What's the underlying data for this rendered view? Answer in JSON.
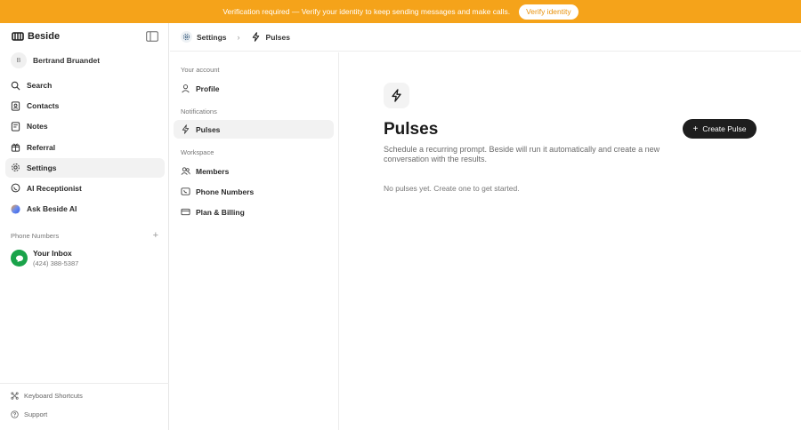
{
  "banner": {
    "message": "Verification required — Verify your identity to keep sending messages and make calls.",
    "button": "Verify identity"
  },
  "brand": {
    "name": "Beside"
  },
  "user": {
    "initial": "B",
    "name": "Bertrand Bruandet"
  },
  "nav": [
    {
      "label": "Search",
      "icon": "search-icon"
    },
    {
      "label": "Contacts",
      "icon": "contacts-icon"
    },
    {
      "label": "Notes",
      "icon": "notes-icon"
    },
    {
      "label": "Referral",
      "icon": "gift-icon"
    },
    {
      "label": "Settings",
      "icon": "gear-icon",
      "active": true
    },
    {
      "label": "AI Receptionist",
      "icon": "receptionist-icon"
    },
    {
      "label": "Ask Beside AI",
      "icon": "ai-orb-icon"
    }
  ],
  "phone_numbers": {
    "heading": "Phone Numbers",
    "inbox": {
      "title": "Your Inbox",
      "number": "(424) 388-5387"
    }
  },
  "footer": {
    "shortcuts": "Keyboard Shortcuts",
    "support": "Support"
  },
  "breadcrumb": {
    "root": "Settings",
    "current": "Pulses"
  },
  "subnav": {
    "account_label": "Your account",
    "profile": "Profile",
    "notifications_label": "Notifications",
    "pulses": "Pulses",
    "workspace_label": "Workspace",
    "members": "Members",
    "phone_numbers": "Phone Numbers",
    "billing": "Plan & Billing"
  },
  "main": {
    "title": "Pulses",
    "create_button": "Create Pulse",
    "description": "Schedule a recurring prompt. Beside will run it automatically and create a new conversation with the results.",
    "empty": "No pulses yet. Create one to get started."
  },
  "colors": {
    "banner": "#f5a31a",
    "inbox_green": "#1aa34a",
    "button_dark": "#1e1e1e"
  }
}
